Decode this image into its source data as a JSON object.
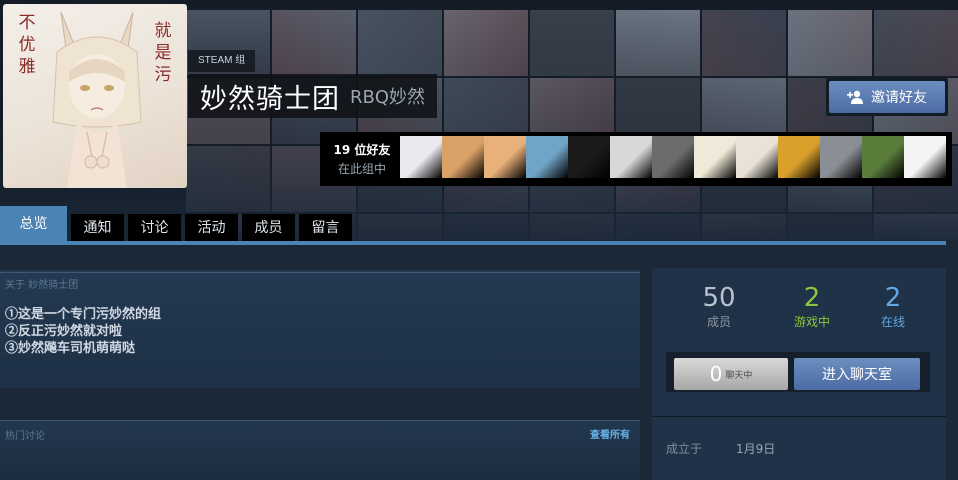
{
  "group": {
    "tag": "STEAM 组",
    "name": "妙然骑士团",
    "abbreviation": "RBQ妙然",
    "avatar_text_left": "不优雅",
    "avatar_text_right": "就是污"
  },
  "invite": {
    "label": "邀请好友",
    "icon": "add-friend-icon"
  },
  "friends": {
    "count_label": "19 位好友",
    "sub_label": "在此组中",
    "avatars": 13
  },
  "tabs": [
    {
      "label": "总览",
      "active": true
    },
    {
      "label": "通知",
      "active": false
    },
    {
      "label": "讨论",
      "active": false
    },
    {
      "label": "活动",
      "active": false
    },
    {
      "label": "成员",
      "active": false
    },
    {
      "label": "留言",
      "active": false
    }
  ],
  "about": {
    "heading": "关于 妙然骑士团",
    "lines": [
      "①这是一个专门污妙然的组",
      "②反正污妙然就对啦",
      "③妙然飚车司机萌萌哒"
    ]
  },
  "discussions": {
    "heading": "热门讨论",
    "view_all": "查看所有"
  },
  "stats": {
    "members": {
      "value": "50",
      "label": "成员",
      "color": "#b8c3cd"
    },
    "in_game": {
      "value": "2",
      "label": "游戏中",
      "color": "#8bc53f"
    },
    "online": {
      "value": "2",
      "label": "在线",
      "color": "#62a7e3"
    }
  },
  "chat": {
    "count": "0",
    "count_label": "聊天中",
    "enter_label": "进入聊天室"
  },
  "founded": {
    "label": "成立于",
    "date": "1月9日"
  },
  "colors": {
    "accent": "#4b83b5",
    "button": "#5a7db5",
    "link": "#66b3e8"
  }
}
